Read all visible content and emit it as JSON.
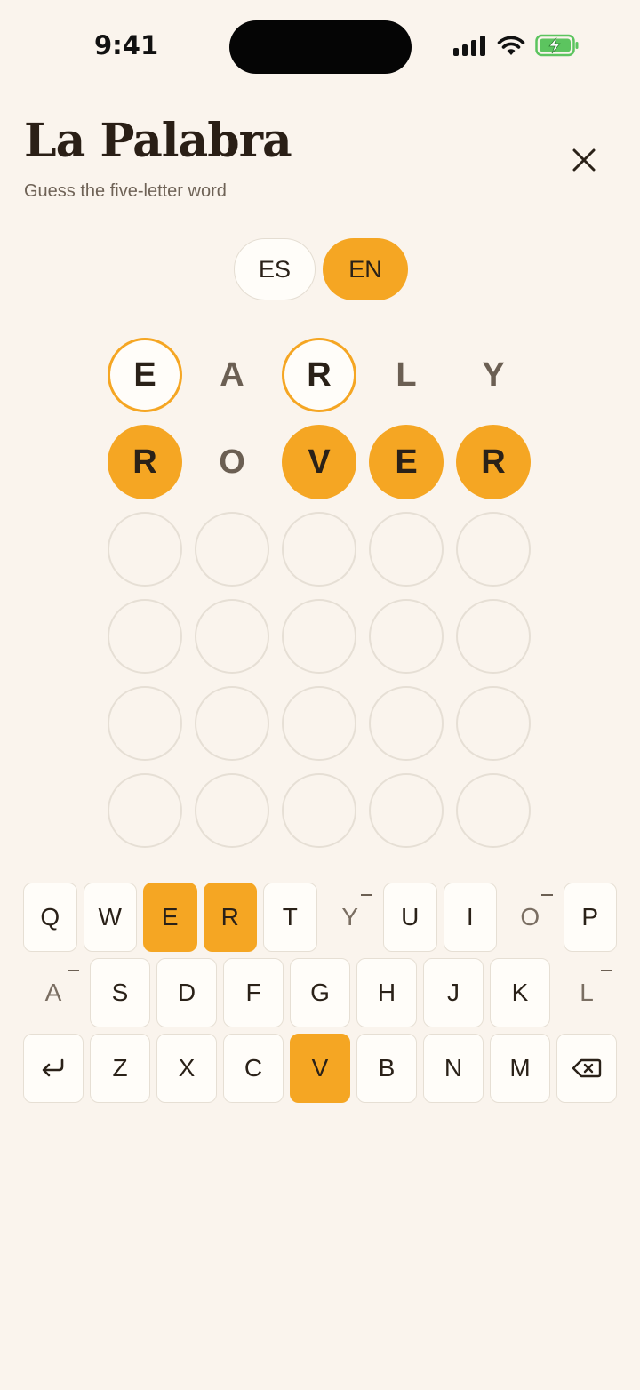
{
  "status": {
    "time": "9:41"
  },
  "header": {
    "title": "La Palabra",
    "subtitle": "Guess the five-letter word"
  },
  "languages": [
    {
      "label": "ES",
      "active": false
    },
    {
      "label": "EN",
      "active": true
    }
  ],
  "board": {
    "rows": [
      [
        {
          "letter": "E",
          "state": "present"
        },
        {
          "letter": "A",
          "state": "miss"
        },
        {
          "letter": "R",
          "state": "present"
        },
        {
          "letter": "L",
          "state": "miss"
        },
        {
          "letter": "Y",
          "state": "miss"
        }
      ],
      [
        {
          "letter": "R",
          "state": "hit"
        },
        {
          "letter": "O",
          "state": "miss"
        },
        {
          "letter": "V",
          "state": "hit"
        },
        {
          "letter": "E",
          "state": "hit"
        },
        {
          "letter": "R",
          "state": "hit"
        }
      ],
      [
        {
          "letter": "",
          "state": "empty"
        },
        {
          "letter": "",
          "state": "empty"
        },
        {
          "letter": "",
          "state": "empty"
        },
        {
          "letter": "",
          "state": "empty"
        },
        {
          "letter": "",
          "state": "empty"
        }
      ],
      [
        {
          "letter": "",
          "state": "empty"
        },
        {
          "letter": "",
          "state": "empty"
        },
        {
          "letter": "",
          "state": "empty"
        },
        {
          "letter": "",
          "state": "empty"
        },
        {
          "letter": "",
          "state": "empty"
        }
      ],
      [
        {
          "letter": "",
          "state": "empty"
        },
        {
          "letter": "",
          "state": "empty"
        },
        {
          "letter": "",
          "state": "empty"
        },
        {
          "letter": "",
          "state": "empty"
        },
        {
          "letter": "",
          "state": "empty"
        }
      ],
      [
        {
          "letter": "",
          "state": "empty"
        },
        {
          "letter": "",
          "state": "empty"
        },
        {
          "letter": "",
          "state": "empty"
        },
        {
          "letter": "",
          "state": "empty"
        },
        {
          "letter": "",
          "state": "empty"
        }
      ]
    ]
  },
  "keyboard": {
    "rows": [
      [
        {
          "label": "Q",
          "state": "default"
        },
        {
          "label": "W",
          "state": "default"
        },
        {
          "label": "E",
          "state": "used"
        },
        {
          "label": "R",
          "state": "used"
        },
        {
          "label": "T",
          "state": "default"
        },
        {
          "label": "Y",
          "state": "dead"
        },
        {
          "label": "U",
          "state": "default"
        },
        {
          "label": "I",
          "state": "default"
        },
        {
          "label": "O",
          "state": "dead"
        },
        {
          "label": "P",
          "state": "default"
        }
      ],
      [
        {
          "label": "A",
          "state": "dead"
        },
        {
          "label": "S",
          "state": "default"
        },
        {
          "label": "D",
          "state": "default"
        },
        {
          "label": "F",
          "state": "default"
        },
        {
          "label": "G",
          "state": "default"
        },
        {
          "label": "H",
          "state": "default"
        },
        {
          "label": "J",
          "state": "default"
        },
        {
          "label": "K",
          "state": "default"
        },
        {
          "label": "L",
          "state": "dead"
        }
      ],
      [
        {
          "label": "",
          "state": "default",
          "icon": "enter-icon"
        },
        {
          "label": "Z",
          "state": "default"
        },
        {
          "label": "X",
          "state": "default"
        },
        {
          "label": "C",
          "state": "default"
        },
        {
          "label": "V",
          "state": "used"
        },
        {
          "label": "B",
          "state": "default"
        },
        {
          "label": "N",
          "state": "default"
        },
        {
          "label": "M",
          "state": "default"
        },
        {
          "label": "",
          "state": "default",
          "icon": "backspace-icon"
        }
      ]
    ]
  },
  "colors": {
    "accent": "#f5a623",
    "background": "#faf4ed",
    "ink": "#2a2118"
  }
}
